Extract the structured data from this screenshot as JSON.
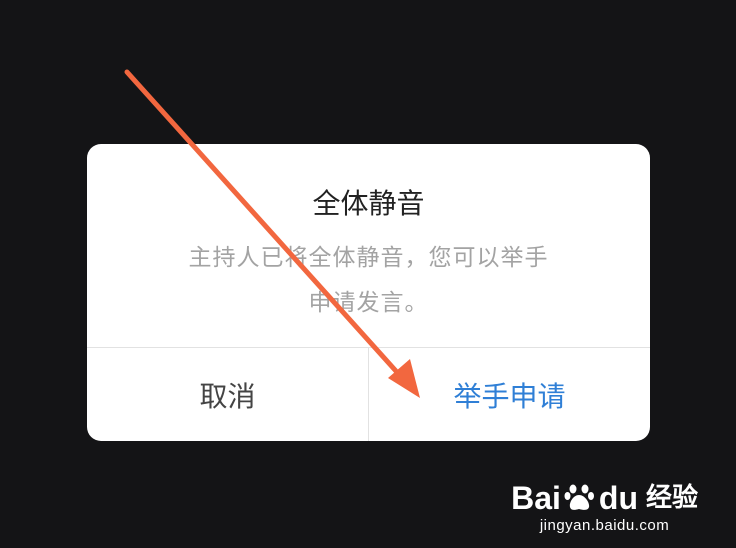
{
  "dialog": {
    "title": "全体静音",
    "message_line1": "主持人已将全体静音，您可以举手",
    "message_line2": "申请发言。",
    "cancel_label": "取消",
    "confirm_label": "举手申请"
  },
  "watermark": {
    "logo_text_left": "Bai",
    "logo_text_right": "du",
    "logo_cn": "经验",
    "url": "jingyan.baidu.com"
  },
  "colors": {
    "background": "#141416",
    "dialog_bg": "#ffffff",
    "confirm_text": "#2f7fd6",
    "annotation_arrow": "#f2673f"
  },
  "icons": {
    "annotation": "arrow-annotation-icon",
    "watermark": "baidu-paw-icon"
  }
}
